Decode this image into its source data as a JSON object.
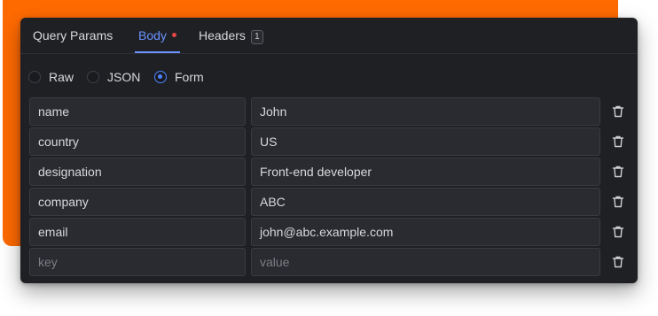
{
  "tabs": {
    "query_params": "Query Params",
    "body": "Body",
    "headers": "Headers",
    "headers_count": "1"
  },
  "body_type": {
    "options": [
      "Raw",
      "JSON",
      "Form"
    ],
    "selected": "Form"
  },
  "form_rows": [
    {
      "key": "name",
      "value": "John"
    },
    {
      "key": "country",
      "value": "US"
    },
    {
      "key": "designation",
      "value": "Front-end developer"
    },
    {
      "key": "company",
      "value": "ABC"
    },
    {
      "key": "email",
      "value": "john@abc.example.com"
    }
  ],
  "new_row": {
    "key_placeholder": "key",
    "value_placeholder": "value"
  },
  "icons": {
    "delete": "trash-icon",
    "modified_indicator": "dot-icon"
  },
  "colors": {
    "accent_background": "#ff6a00",
    "active_tab": "#6a93ff",
    "radio_checked": "#4c84ff",
    "modified_dot": "#e04848",
    "panel_background": "#1f2024"
  }
}
